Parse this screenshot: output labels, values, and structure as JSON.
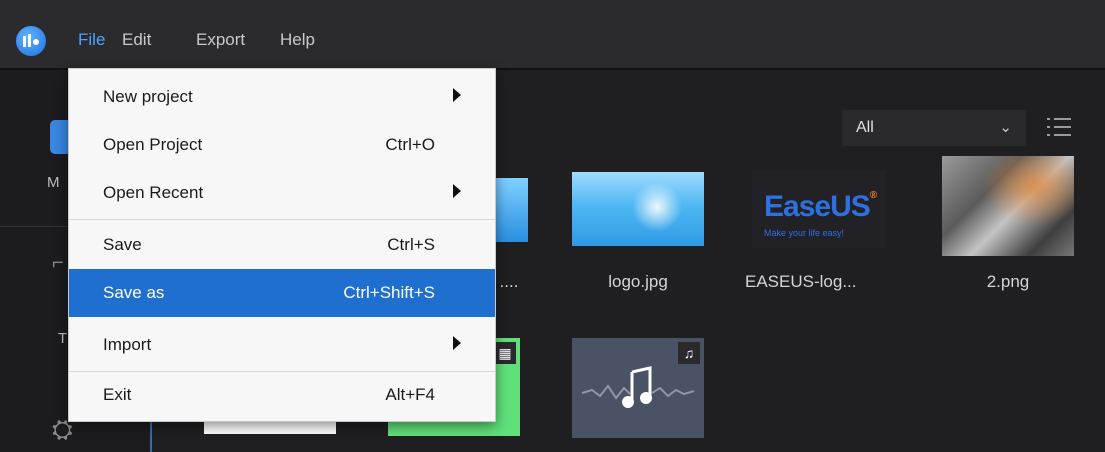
{
  "menubar": {
    "items": [
      {
        "label": "File",
        "active": true
      },
      {
        "label": "Edit"
      },
      {
        "label": "Export"
      },
      {
        "label": "Help"
      }
    ]
  },
  "sidebar": {
    "labels": [
      "M",
      "T"
    ]
  },
  "toolbar": {
    "filter_value": "All",
    "filter_icon": "chevron-down-icon",
    "view_icon": "list-view-icon"
  },
  "media": {
    "items": [
      {
        "name": "....",
        "type": "image"
      },
      {
        "name": "logo.jpg",
        "type": "image"
      },
      {
        "name": "EASEUS-log...",
        "type": "image",
        "brand_text": "EaseUS",
        "brand_tagline": "Make your life easy!"
      },
      {
        "name": "2.png",
        "type": "image"
      }
    ],
    "row2": [
      {
        "type": "image"
      },
      {
        "type": "video",
        "badge_icon": "film-icon"
      },
      {
        "type": "audio",
        "badge_icon": "music-note-icon"
      }
    ]
  },
  "file_menu": {
    "items": [
      {
        "label": "New project",
        "shortcut": "",
        "submenu": true
      },
      {
        "label": "Open Project",
        "shortcut": "Ctrl+O"
      },
      {
        "label": "Open Recent",
        "shortcut": "",
        "submenu": true
      },
      {
        "label": "Save",
        "shortcut": "Ctrl+S"
      },
      {
        "label": "Save as",
        "shortcut": "Ctrl+Shift+S",
        "highlighted": true
      },
      {
        "label": "Import",
        "shortcut": "",
        "submenu": true
      },
      {
        "label": "Exit",
        "shortcut": "Alt+F4"
      }
    ]
  },
  "colors": {
    "accent": "#1e6fd0",
    "menu_active": "#4aa3ff",
    "background": "#1f1f21"
  }
}
